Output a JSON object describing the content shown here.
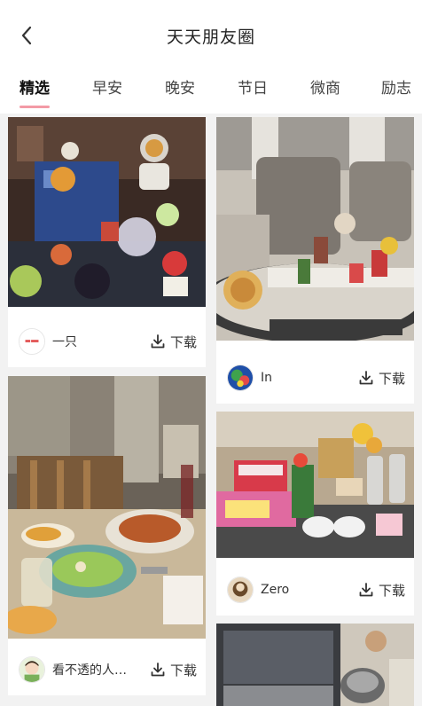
{
  "header": {
    "title": "天天朋友圈"
  },
  "tabs": [
    {
      "label": "精选",
      "active": true
    },
    {
      "label": "早安",
      "active": false
    },
    {
      "label": "晚安",
      "active": false
    },
    {
      "label": "节日",
      "active": false
    },
    {
      "label": "微商",
      "active": false
    },
    {
      "label": "励志",
      "active": false
    }
  ],
  "posts": [
    {
      "user": "一只",
      "download_label": "下载",
      "photo": "dessert-tower-astronauts"
    },
    {
      "user": "In",
      "download_label": "下载",
      "photo": "ritz-carlton-afternoon-tea"
    },
    {
      "user": "看不透的人…",
      "download_label": "下载",
      "photo": "restaurant-table-dinner"
    },
    {
      "user": "Zero",
      "download_label": "下载",
      "photo": "party-table-gifts"
    },
    {
      "user": "",
      "download_label": "",
      "photo": "laptop-desk"
    }
  ],
  "colors": {
    "accent": "#f39aa6",
    "background": "#f2f2f2",
    "card": "#ffffff"
  }
}
